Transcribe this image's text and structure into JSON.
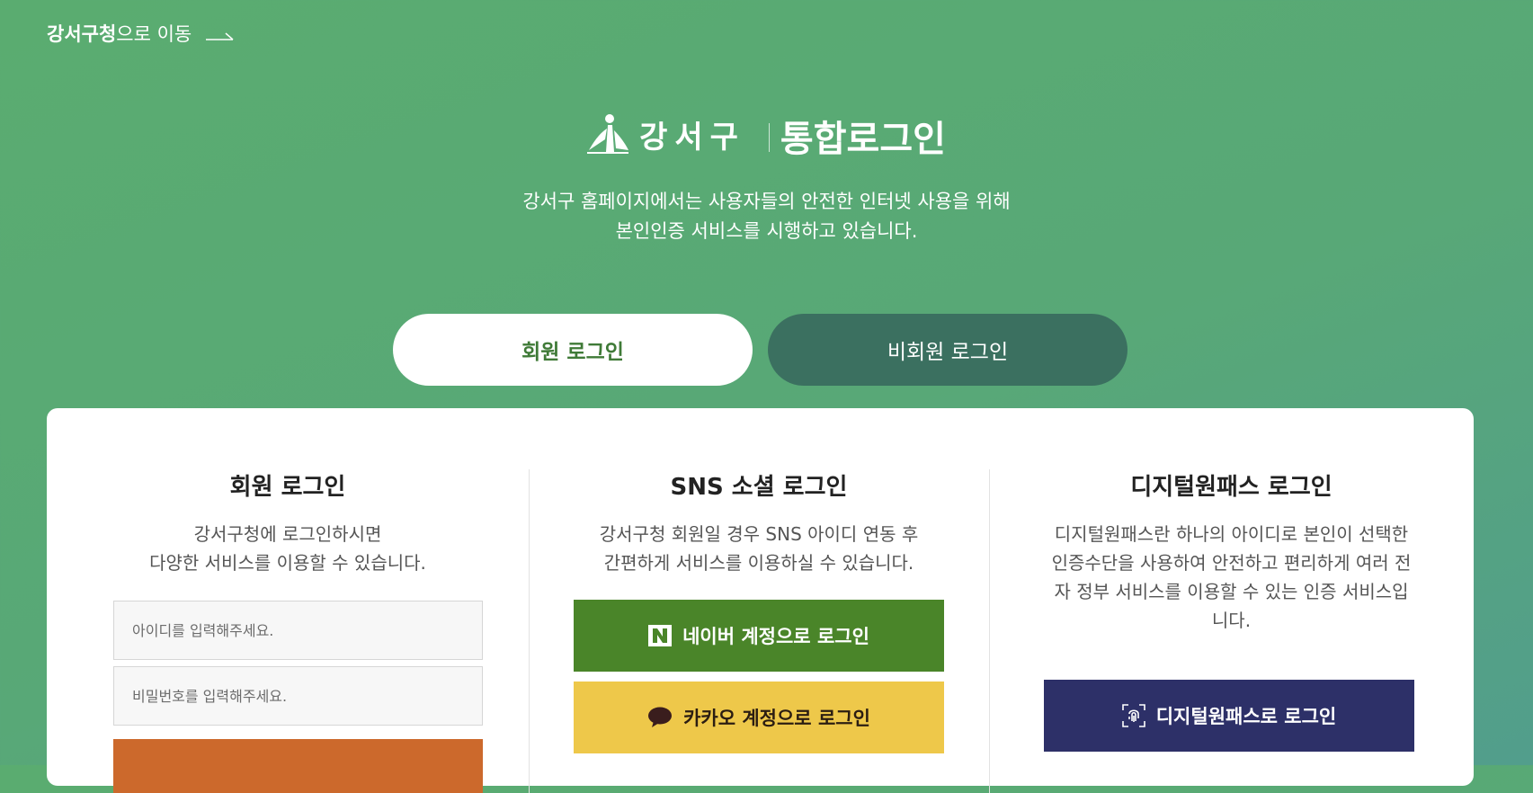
{
  "top_link": {
    "strong": "강서구청",
    "rest": "으로 이동"
  },
  "header": {
    "logo_text": "강서구",
    "title": "통합로그인",
    "intro_line1": "강서구 홈페이지에서는 사용자들의 안전한 인터넷 사용을 위해",
    "intro_line2": "본인인증 서비스를 시행하고 있습니다."
  },
  "tabs": [
    {
      "label": "회원 로그인",
      "active": true
    },
    {
      "label": "비회원 로그인",
      "active": false
    }
  ],
  "member_login": {
    "title": "회원 로그인",
    "desc_line1": "강서구청에 로그인하시면",
    "desc_line2": "다양한 서비스를 이용할 수 있습니다.",
    "id_placeholder": "아이디를 입력해주세요.",
    "pw_placeholder": "비밀번호를 입력해주세요."
  },
  "sns_login": {
    "title": "SNS 소셜 로그인",
    "desc_line1": "강서구청 회원일 경우 SNS 아이디 연동 후",
    "desc_line2": "간편하게 서비스를 이용하실 수 있습니다.",
    "naver_label": "네이버 계정으로 로그인",
    "kakao_label": "카카오 계정으로 로그인"
  },
  "digital_onepass": {
    "title": "디지털원패스 로그인",
    "desc": "디지털원패스란 하나의 아이디로 본인이 선택한 인증수단을 사용하여 안전하고 편리하게 여러 전자 정부 서비스를 이용할 수 있는 인증 서비스입니다.",
    "button_label": "디지털원패스로 로그인"
  },
  "colors": {
    "bg_green": "#5aac70",
    "tab_inactive": "#3b7060",
    "naver": "#4a8529",
    "kakao": "#eec84a",
    "onepass": "#2d3068",
    "login_button": "#cc692c"
  },
  "icons": [
    "arrow-right-icon",
    "gangseo-logo-icon",
    "naver-n-icon",
    "kakao-bubble-icon",
    "fingerprint-icon"
  ]
}
